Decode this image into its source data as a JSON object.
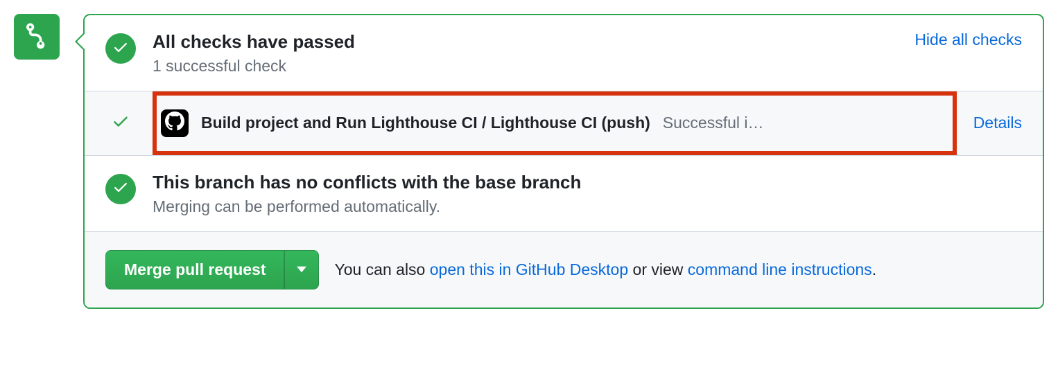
{
  "checks": {
    "title": "All checks have passed",
    "subtitle": "1 successful check",
    "toggle_label": "Hide all checks",
    "items": [
      {
        "name": "Build project and Run Lighthouse CI / Lighthouse CI (push)",
        "status_text": "Successful i…",
        "details_label": "Details"
      }
    ]
  },
  "conflicts": {
    "title": "This branch has no conflicts with the base branch",
    "subtitle": "Merging can be performed automatically."
  },
  "merge": {
    "button_label": "Merge pull request",
    "text_prefix": "You can also ",
    "desktop_link": "open this in GitHub Desktop",
    "text_mid": " or view ",
    "cli_link": "command line instructions",
    "text_suffix": "."
  }
}
